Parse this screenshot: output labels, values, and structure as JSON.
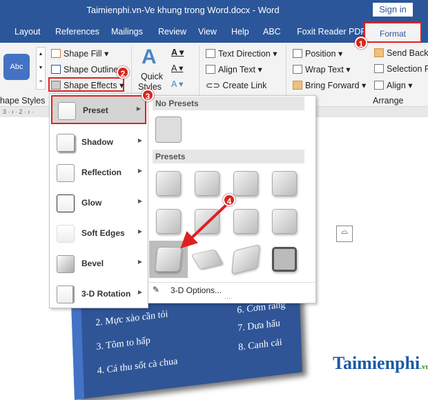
{
  "window": {
    "title": "Taimienphi.vn-Ve khung trong Word.docx  -  Word",
    "sign_in": "Sign in"
  },
  "tabs": [
    "Layout",
    "References",
    "Mailings",
    "Review",
    "View",
    "Help",
    "ABC",
    "Foxit Reader PDF",
    "Format"
  ],
  "ribbon": {
    "style_sample": "Abc",
    "shape_styles_group": "hape Styles",
    "shape_fill": "Shape Fill",
    "shape_outline": "Shape Outline",
    "shape_effects": "Shape Effects",
    "quick_styles": "Quick",
    "quick_styles2": "Styles",
    "text_direction": "Text Direction",
    "align_text": "Align Text",
    "create_link": "Create Link",
    "position": "Position",
    "wrap_text": "Wrap Text",
    "bring_forward": "Bring Forward",
    "send_backward": "Send Backw",
    "selection_pane": "Selection Pa",
    "align": "Align",
    "arrange_group": "Arrange",
    "accent": "#2b579a"
  },
  "ruler": "3 · ı · 2 · ı ·                                                                                   ı · ı · 10 · ı · 11 · ı · 12 · ı · 13 ·",
  "effects_menu": {
    "items": [
      "Preset",
      "Shadow",
      "Reflection",
      "Glow",
      "Soft Edges",
      "Bevel",
      "3-D Rotation"
    ],
    "selected": "Preset"
  },
  "preset_submenu": {
    "no_presets": "No Presets",
    "presets": "Presets",
    "options": "3-D Options...",
    "selected_index": 8,
    "preset_count": 12
  },
  "badges": [
    "1",
    "2",
    "3",
    "4"
  ],
  "document": {
    "items": [
      "2. Mực xào cần tỏi",
      "3. Tôm to hấp",
      "4. Cá thu sốt cà chua",
      "6. Cơm rang",
      "7. Dưa hấu",
      "8. Canh cải"
    ]
  },
  "watermark": "Taimienphi.vn"
}
